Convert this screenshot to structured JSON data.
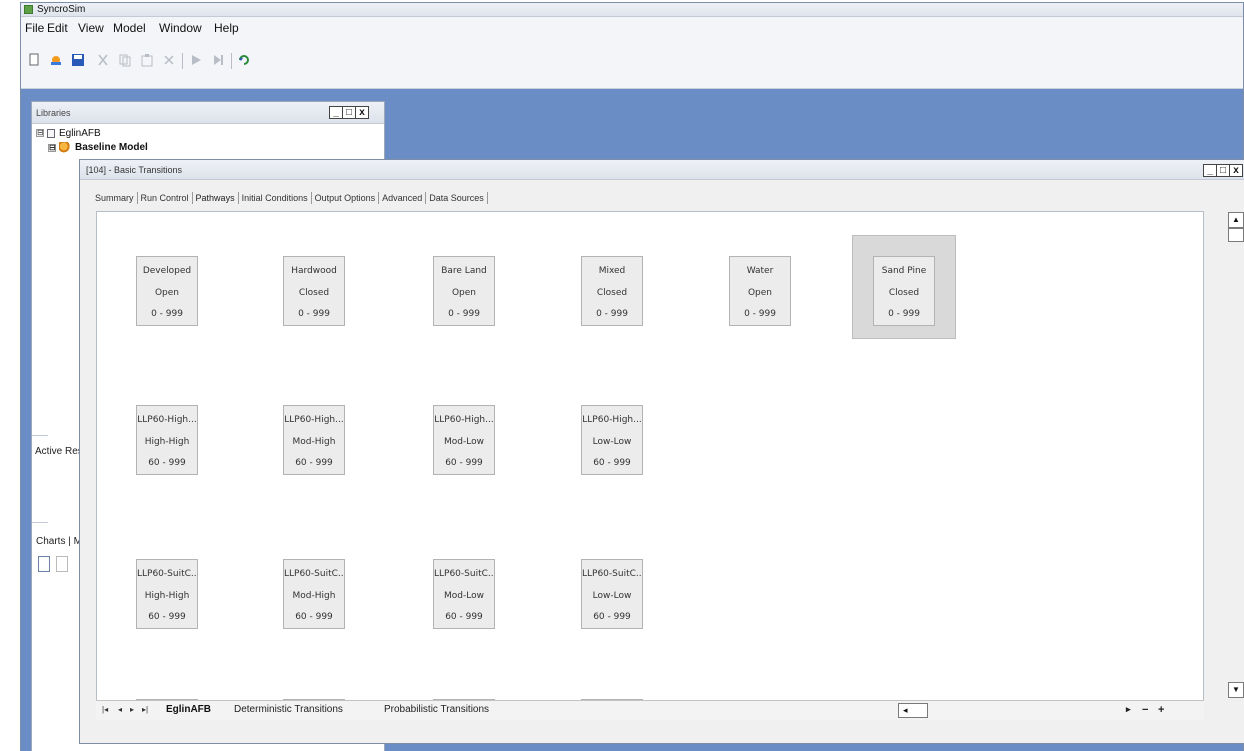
{
  "window": {
    "title": "SyncroSim"
  },
  "menu": [
    "File",
    "Edit",
    "View",
    "Model",
    "Window",
    "Help"
  ],
  "toolbar": {
    "icons": [
      "new-icon",
      "open-icon",
      "save-icon",
      "cut-icon",
      "copy-icon",
      "paste-icon",
      "delete-icon",
      "run-icon",
      "run-all-icon",
      "refresh-icon"
    ]
  },
  "libraries": {
    "title": "Libraries",
    "win_buttons": [
      "_",
      "□",
      "x"
    ],
    "tree": [
      {
        "label": "EglinAFB",
        "expander": "⊟"
      },
      {
        "label": "Baseline Model",
        "expander": "⊟"
      }
    ],
    "active_results_label": "Active Res",
    "charts_tab": "Charts | M"
  },
  "scenario": {
    "title": "[104] - Basic Transitions",
    "win_buttons": [
      "_",
      "□",
      "x"
    ],
    "tabs": [
      "Summary",
      "Run Control",
      "Pathways",
      "Initial Conditions",
      "Output Options",
      "Advanced",
      "Data Sources"
    ],
    "active_tab": "Pathways",
    "state_classes": [
      {
        "l1": "Developed",
        "l2": "Open",
        "l3": "0 - 999"
      },
      {
        "l1": "Hardwood",
        "l2": "Closed",
        "l3": "0 - 999"
      },
      {
        "l1": "Bare Land",
        "l2": "Open",
        "l3": "0 - 999"
      },
      {
        "l1": "Mixed",
        "l2": "Closed",
        "l3": "0 - 999"
      },
      {
        "l1": "Water",
        "l2": "Open",
        "l3": "0 - 999"
      },
      {
        "l1": "Sand Pine",
        "l2": "Closed",
        "l3": "0 - 999",
        "selected": true
      },
      {
        "l1": "LLP60-High...",
        "l2": "High-High",
        "l3": "60 - 999"
      },
      {
        "l1": "LLP60-High...",
        "l2": "Mod-High",
        "l3": "60 - 999"
      },
      {
        "l1": "LLP60-High...",
        "l2": "Mod-Low",
        "l3": "60 - 999"
      },
      {
        "l1": "LLP60-High...",
        "l2": "Low-Low",
        "l3": "60 - 999"
      },
      {
        "l1": "LLP60-SuitC...",
        "l2": "High-High",
        "l3": "60 - 999"
      },
      {
        "l1": "LLP60-SuitC...",
        "l2": "Mod-High",
        "l3": "60 - 999"
      },
      {
        "l1": "LLP60-SuitC...",
        "l2": "Mod-Low",
        "l3": "60 - 999"
      },
      {
        "l1": "LLP60-SuitC...",
        "l2": "Low-Low",
        "l3": "60 - 999"
      }
    ],
    "sheet_tabs": [
      "EglinAFB",
      "Deterministic Transitions",
      "Probabilistic Transitions"
    ],
    "active_sheet": "EglinAFB",
    "nav_buttons": [
      "|◂",
      "◂",
      "▸",
      "▸|"
    ],
    "zoom_minus": "−",
    "zoom_plus": "+"
  }
}
